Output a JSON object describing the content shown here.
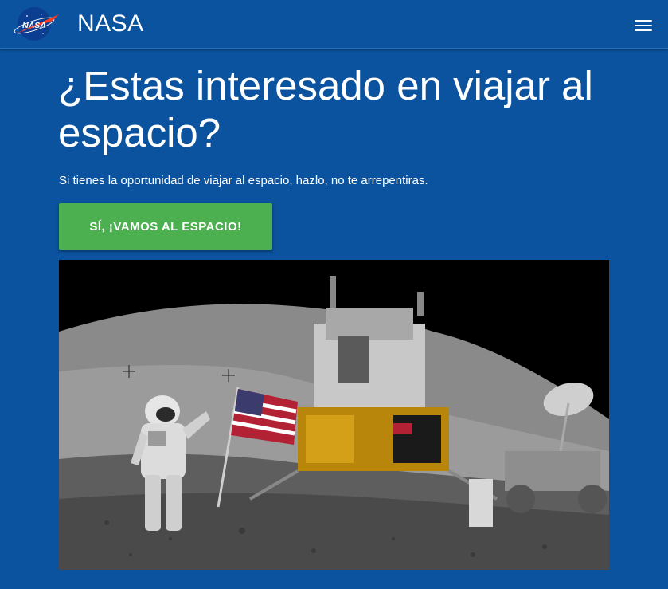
{
  "navbar": {
    "logo_text": "NASA",
    "brand": "NASA",
    "menu_icon": "hamburger-menu-icon"
  },
  "hero": {
    "title": "¿Estas interesado en viajar al espacio?",
    "subtitle": "Si tienes la oportunidad de viajar al espacio, hazlo, no te arrepentiras.",
    "cta_label": "SÍ, ¡VAMOS AL ESPACIO!"
  },
  "colors": {
    "background": "#0b539f",
    "cta": "#4caf50",
    "text": "#ffffff"
  }
}
